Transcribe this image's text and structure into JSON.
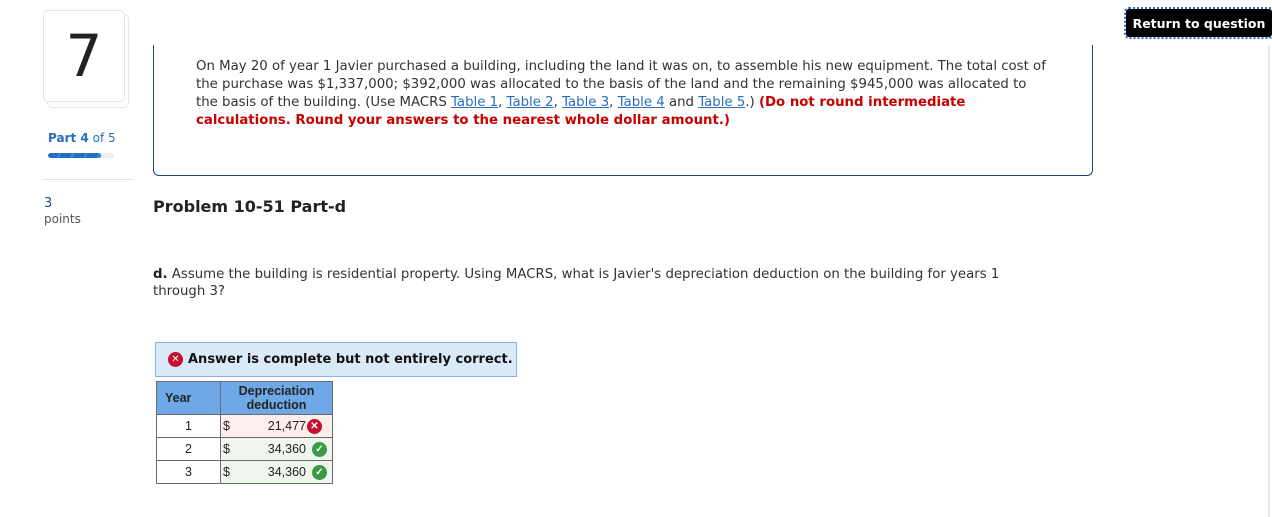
{
  "sidebar": {
    "question_number": "7",
    "part_prefix": "Part",
    "part_current": "4",
    "part_suffix": "of 5",
    "progress_fraction": 0.8,
    "points_value": "3",
    "points_label": "points"
  },
  "header": {
    "return_button": "Return to question"
  },
  "question": {
    "text_1": "On May 20 of year 1 Javier purchased a building, including the land it was on, to assemble his new equipment. The total cost of the purchase was $1,337,000; $392,000 was allocated to the basis of the land and the remaining $945,000 was allocated to the basis of the building. (Use MACRS ",
    "links": [
      "Table 1",
      "Table 2",
      "Table 3",
      "Table 4",
      "Table 5"
    ],
    "sep_comma": ", ",
    "sep_and": " and ",
    "text_after_links": ".) ",
    "warning": "(Do not round intermediate calculations. Round your answers to the nearest whole dollar amount.)"
  },
  "problem": {
    "title": "Problem 10-51 Part-d",
    "part_letter": "d.",
    "part_text": " Assume the building is residential property. Using MACRS, what is Javier's depreciation deduction on the building for years 1 through 3?"
  },
  "feedback": {
    "status_icon": "x-circle-icon",
    "message": "Answer is complete but not entirely correct."
  },
  "answer_table": {
    "headers": [
      "Year",
      "Depreciation deduction"
    ],
    "rows": [
      {
        "year": "1",
        "currency": "$",
        "value": "21,477",
        "status": "incorrect"
      },
      {
        "year": "2",
        "currency": "$",
        "value": "34,360",
        "status": "correct"
      },
      {
        "year": "3",
        "currency": "$",
        "value": "34,360",
        "status": "correct"
      }
    ]
  },
  "colors": {
    "link": "#2a6ebb",
    "warning": "#c80000",
    "incorrect": "#c8102e",
    "correct": "#3a9a45",
    "table_header": "#6fa8e6",
    "banner_bg": "#dbeaf9"
  }
}
